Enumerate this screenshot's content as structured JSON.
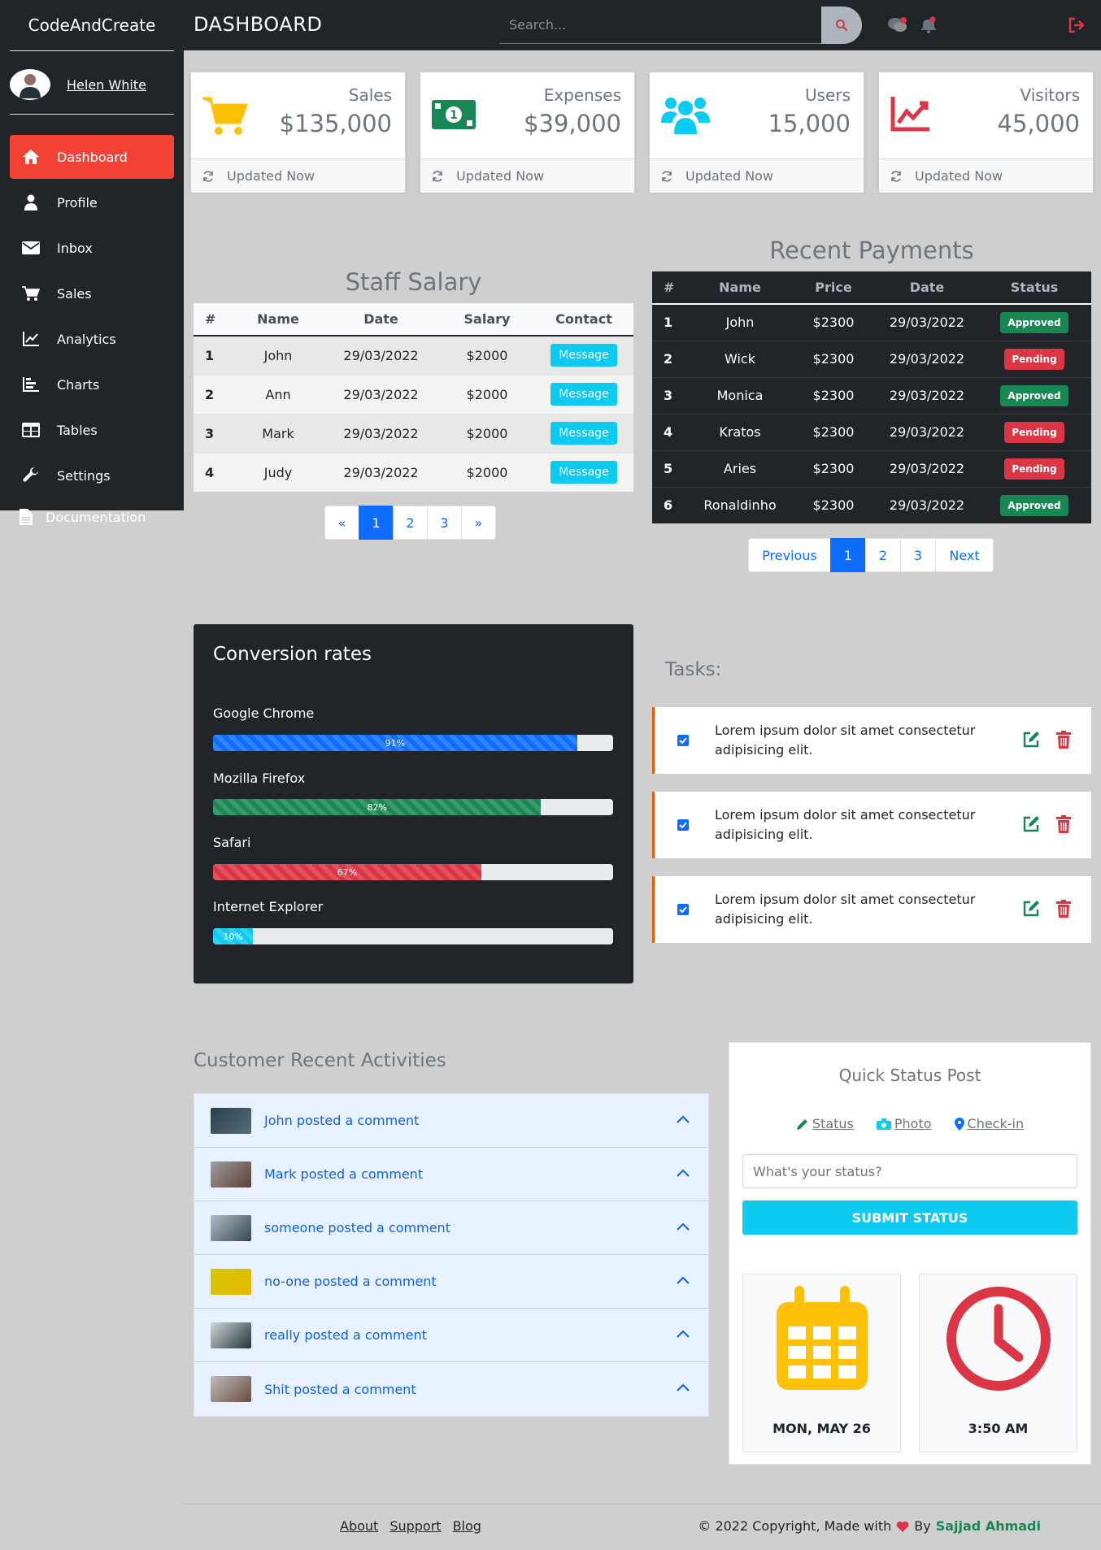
{
  "app": {
    "brand": "CodeAndCreate",
    "page_title": "DASHBOARD",
    "search_placeholder": "Search..."
  },
  "sidebar": {
    "user_name": "Helen White",
    "items": [
      {
        "label": "Dashboard",
        "icon": "home-icon",
        "active": true
      },
      {
        "label": "Profile",
        "icon": "user-icon"
      },
      {
        "label": "Inbox",
        "icon": "envelope-icon"
      },
      {
        "label": "Sales",
        "icon": "cart-icon"
      },
      {
        "label": "Analytics",
        "icon": "line-chart-icon"
      },
      {
        "label": "Charts",
        "icon": "bar-chart-icon"
      },
      {
        "label": "Tables",
        "icon": "table-icon"
      },
      {
        "label": "Settings",
        "icon": "wrench-icon"
      }
    ],
    "documentation": "Documentation"
  },
  "stats": [
    {
      "label": "Sales",
      "value": "$135,000",
      "footer": "Updated Now",
      "color": "#ffc107",
      "icon": "cart-icon"
    },
    {
      "label": "Expenses",
      "value": "$39,000",
      "footer": "Updated Now",
      "color": "#198754",
      "icon": "money-icon"
    },
    {
      "label": "Users",
      "value": "15,000",
      "footer": "Updated Now",
      "color": "#0dcaf0",
      "icon": "users-icon"
    },
    {
      "label": "Visitors",
      "value": "45,000",
      "footer": "Updated Now",
      "color": "#dc3545",
      "icon": "line-chart-icon"
    }
  ],
  "staff_salary": {
    "title": "Staff Salary",
    "headers": [
      "#",
      "Name",
      "Date",
      "Salary",
      "Contact"
    ],
    "rows": [
      {
        "num": "1",
        "name": "John",
        "date": "29/03/2022",
        "salary": "$2000",
        "action": "Message"
      },
      {
        "num": "2",
        "name": "Ann",
        "date": "29/03/2022",
        "salary": "$2000",
        "action": "Message"
      },
      {
        "num": "3",
        "name": "Mark",
        "date": "29/03/2022",
        "salary": "$2000",
        "action": "Message"
      },
      {
        "num": "4",
        "name": "Judy",
        "date": "29/03/2022",
        "salary": "$2000",
        "action": "Message"
      }
    ],
    "pagination": [
      "«",
      "1",
      "2",
      "3",
      "»"
    ],
    "active_page": "1"
  },
  "recent_payments": {
    "title": "Recent Payments",
    "headers": [
      "#",
      "Name",
      "Price",
      "Date",
      "Status"
    ],
    "rows": [
      {
        "num": "1",
        "name": "John",
        "price": "$2300",
        "date": "29/03/2022",
        "status": "Approved"
      },
      {
        "num": "2",
        "name": "Wick",
        "price": "$2300",
        "date": "29/03/2022",
        "status": "Pending"
      },
      {
        "num": "3",
        "name": "Monica",
        "price": "$2300",
        "date": "29/03/2022",
        "status": "Approved"
      },
      {
        "num": "4",
        "name": "Kratos",
        "price": "$2300",
        "date": "29/03/2022",
        "status": "Pending"
      },
      {
        "num": "5",
        "name": "Aries",
        "price": "$2300",
        "date": "29/03/2022",
        "status": "Pending"
      },
      {
        "num": "6",
        "name": "Ronaldinho",
        "price": "$2300",
        "date": "29/03/2022",
        "status": "Approved"
      }
    ],
    "pagination": [
      "Previous",
      "1",
      "2",
      "3",
      "Next"
    ],
    "active_page": "1",
    "status_colors": {
      "Approved": "#198754",
      "Pending": "#dc3545"
    }
  },
  "conversion": {
    "title": "Conversion rates",
    "items": [
      {
        "label": "Google Chrome",
        "value": 91,
        "text": "91%",
        "color": "#0d6efd"
      },
      {
        "label": "Mozilla Firefox",
        "value": 82,
        "text": "82%",
        "color": "#198754"
      },
      {
        "label": "Safari",
        "value": 67,
        "text": "67%",
        "color": "#dc3545"
      },
      {
        "label": "Internet Explorer",
        "value": 10,
        "text": "10%",
        "color": "#0dcaf0"
      }
    ]
  },
  "tasks": {
    "title": "Tasks:",
    "items": [
      {
        "text": "Lorem ipsum dolor sit amet consectetur adipisicing elit.",
        "checked": true
      },
      {
        "text": "Lorem ipsum dolor sit amet consectetur adipisicing elit.",
        "checked": true
      },
      {
        "text": "Lorem ipsum dolor sit amet consectetur adipisicing elit.",
        "checked": true
      }
    ]
  },
  "activities": {
    "title": "Customer Recent Activities",
    "items": [
      {
        "text": "John posted a comment"
      },
      {
        "text": "Mark posted a comment"
      },
      {
        "text": "someone posted a comment"
      },
      {
        "text": "no-one posted a comment"
      },
      {
        "text": "really posted a comment"
      },
      {
        "text": "Shit posted a comment"
      }
    ]
  },
  "quick_status": {
    "title": "Quick Status Post",
    "links": [
      "Status",
      "Photo",
      "Check-in"
    ],
    "placeholder": "What's your status?",
    "submit": "SUBMIT STATUS",
    "date": "MON, MAY 26",
    "time": "3:50 AM"
  },
  "footer": {
    "links": [
      "About",
      "Support",
      "Blog"
    ],
    "copyright": "© 2022 Copyright, Made with",
    "by": "By",
    "author": "Sajjad Ahmadi"
  }
}
